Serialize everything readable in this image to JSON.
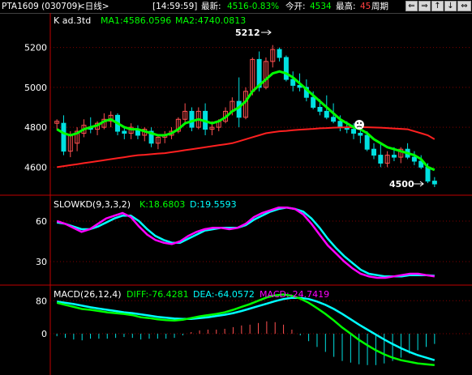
{
  "topbar": {
    "symbol": "PTA1609 (030709)",
    "period": "<日线>",
    "time": "[14:59:59]",
    "latest_label": "最新:",
    "latest_value": "4516",
    "change": "-0.83%",
    "open_label": "今开:",
    "open_value": "4534",
    "high_label": "最高:",
    "high_value": "45",
    "cycle_label": "周期",
    "nav_buttons": [
      "⇐",
      "⇒",
      "↑",
      "↓",
      "⇔"
    ]
  },
  "colors": {
    "background": "#000000",
    "grid": "#800000",
    "up": "#ff5050",
    "down": "#00e0e0",
    "ma1": "#ff00ff",
    "ma2": "#ff2020",
    "kline_overlay": "#00ff00",
    "axis_text": "#ffffff",
    "label_green": "#00ff00",
    "label_cyan": "#00ffff",
    "label_magenta": "#ff00ff",
    "label_yellow": "#ffff00"
  },
  "price_panel": {
    "title": "K  ad.3td",
    "ma1_label": "MA1:4586.0596",
    "ma2_label": "MA2:4740.0813",
    "high_annotation": "5212",
    "low_annotation": "4500",
    "yticks": [
      5200,
      5000,
      4800,
      4600
    ]
  },
  "kd_panel": {
    "title": "SLOWKD(9,3,3,2)",
    "k_label": "K:18.6803",
    "d_label": "D:19.5593",
    "yticks": [
      60,
      30
    ]
  },
  "macd_panel": {
    "title": "MACD(26,12,4)",
    "diff_label": "DIFF:-76.4281",
    "dea_label": "DEA:-64.0572",
    "macd_label": "MACD:-24.7419",
    "yticks": [
      80,
      0
    ]
  },
  "chart_data": [
    {
      "type": "candlestick",
      "title": "",
      "ylim": [
        4500,
        5300
      ],
      "candles": [
        [
          4820,
          4840,
          4790,
          4830
        ],
        [
          4820,
          4860,
          4660,
          4680
        ],
        [
          4680,
          4780,
          4650,
          4760
        ],
        [
          4720,
          4800,
          4680,
          4780
        ],
        [
          4770,
          4840,
          4750,
          4810
        ],
        [
          4800,
          4850,
          4770,
          4790
        ],
        [
          4790,
          4830,
          4760,
          4820
        ],
        [
          4800,
          4870,
          4790,
          4840
        ],
        [
          4830,
          4880,
          4800,
          4860
        ],
        [
          4860,
          4870,
          4760,
          4780
        ],
        [
          4780,
          4800,
          4740,
          4770
        ],
        [
          4770,
          4820,
          4740,
          4800
        ],
        [
          4790,
          4810,
          4740,
          4760
        ],
        [
          4760,
          4800,
          4730,
          4790
        ],
        [
          4780,
          4800,
          4700,
          4720
        ],
        [
          4720,
          4760,
          4690,
          4750
        ],
        [
          4750,
          4780,
          4720,
          4760
        ],
        [
          4760,
          4800,
          4740,
          4780
        ],
        [
          4780,
          4850,
          4770,
          4840
        ],
        [
          4840,
          4920,
          4820,
          4880
        ],
        [
          4880,
          4900,
          4780,
          4800
        ],
        [
          4800,
          4900,
          4790,
          4880
        ],
        [
          4880,
          4920,
          4760,
          4790
        ],
        [
          4790,
          4830,
          4760,
          4800
        ],
        [
          4800,
          4840,
          4780,
          4830
        ],
        [
          4830,
          4900,
          4820,
          4880
        ],
        [
          4880,
          4950,
          4860,
          4930
        ],
        [
          4930,
          5050,
          4800,
          4850
        ],
        [
          4850,
          5000,
          4840,
          4980
        ],
        [
          4980,
          5150,
          4960,
          5140
        ],
        [
          5140,
          5180,
          4980,
          5000
        ],
        [
          5000,
          5150,
          4990,
          5130
        ],
        [
          5130,
          5212,
          5100,
          5190
        ],
        [
          5190,
          5200,
          5130,
          5150
        ],
        [
          5150,
          5160,
          5030,
          5040
        ],
        [
          5040,
          5080,
          4980,
          5010
        ],
        [
          5010,
          5070,
          4980,
          5000
        ],
        [
          5000,
          5040,
          4930,
          4950
        ],
        [
          4950,
          4980,
          4890,
          4900
        ],
        [
          4900,
          4940,
          4860,
          4880
        ],
        [
          4880,
          4960,
          4840,
          4850
        ],
        [
          4850,
          4920,
          4820,
          4830
        ],
        [
          4830,
          4860,
          4780,
          4800
        ],
        [
          4800,
          4830,
          4770,
          4790
        ],
        [
          4790,
          4820,
          4740,
          4770
        ],
        [
          4770,
          4800,
          4720,
          4760
        ],
        [
          4760,
          4780,
          4680,
          4690
        ],
        [
          4690,
          4720,
          4640,
          4660
        ],
        [
          4660,
          4720,
          4600,
          4620
        ],
        [
          4620,
          4680,
          4600,
          4660
        ],
        [
          4660,
          4700,
          4630,
          4650
        ],
        [
          4650,
          4700,
          4620,
          4690
        ],
        [
          4690,
          4720,
          4640,
          4650
        ],
        [
          4650,
          4680,
          4610,
          4630
        ],
        [
          4630,
          4660,
          4590,
          4600
        ],
        [
          4600,
          4620,
          4520,
          4530
        ],
        [
          4530,
          4550,
          4500,
          4516
        ]
      ],
      "ma1": [
        4790,
        4770,
        4760,
        4770,
        4790,
        4800,
        4810,
        4830,
        4840,
        4820,
        4800,
        4790,
        4790,
        4780,
        4770,
        4760,
        4760,
        4770,
        4790,
        4820,
        4830,
        4840,
        4830,
        4820,
        4830,
        4850,
        4880,
        4900,
        4930,
        4980,
        5010,
        5040,
        5070,
        5080,
        5070,
        5050,
        5020,
        4990,
        4960,
        4930,
        4900,
        4870,
        4840,
        4820,
        4800,
        4790,
        4770,
        4740,
        4720,
        4700,
        4690,
        4680,
        4670,
        4660,
        4640,
        4600,
        4586
      ],
      "ma2": [
        4600,
        4605,
        4610,
        4615,
        4620,
        4625,
        4630,
        4635,
        4640,
        4645,
        4650,
        4655,
        4660,
        4662,
        4665,
        4668,
        4670,
        4675,
        4680,
        4685,
        4690,
        4695,
        4700,
        4705,
        4710,
        4715,
        4720,
        4730,
        4740,
        4750,
        4760,
        4770,
        4775,
        4780,
        4782,
        4785,
        4788,
        4790,
        4792,
        4795,
        4796,
        4798,
        4799,
        4800,
        4800,
        4800,
        4800,
        4799,
        4798,
        4796,
        4794,
        4792,
        4790,
        4780,
        4770,
        4760,
        4740
      ]
    },
    {
      "type": "line",
      "title": "SLOWKD(9,3,3,2)",
      "ylim": [
        15,
        75
      ],
      "series": [
        {
          "name": "K",
          "values": [
            60,
            58,
            55,
            52,
            54,
            58,
            62,
            64,
            66,
            63,
            56,
            50,
            46,
            44,
            43,
            45,
            49,
            52,
            54,
            55,
            55,
            54,
            55,
            58,
            63,
            66,
            68,
            70,
            70,
            69,
            65,
            58,
            50,
            42,
            36,
            30,
            25,
            21,
            19,
            18,
            18,
            19,
            20,
            21,
            21,
            20,
            19
          ]
        },
        {
          "name": "D",
          "values": [
            59,
            58,
            56,
            54,
            54,
            56,
            59,
            62,
            64,
            64,
            60,
            54,
            49,
            46,
            44,
            44,
            47,
            50,
            53,
            54,
            55,
            55,
            55,
            57,
            61,
            64,
            67,
            69,
            70,
            69,
            67,
            62,
            55,
            47,
            40,
            34,
            29,
            24,
            21,
            20,
            19,
            19,
            19,
            20,
            20,
            20,
            19.5
          ]
        }
      ]
    },
    {
      "type": "line",
      "title": "MACD(26,12,4)",
      "ylim": [
        -100,
        110
      ],
      "series": [
        {
          "name": "DIFF",
          "values": [
            75,
            70,
            65,
            60,
            58,
            55,
            52,
            50,
            48,
            45,
            40,
            38,
            35,
            33,
            32,
            34,
            38,
            42,
            45,
            48,
            52,
            58,
            65,
            72,
            80,
            88,
            93,
            95,
            92,
            85,
            75,
            62,
            48,
            32,
            15,
            0,
            -15,
            -28,
            -40,
            -50,
            -58,
            -64,
            -68,
            -72,
            -74,
            -76
          ]
        },
        {
          "name": "DEA",
          "values": [
            78,
            75,
            72,
            68,
            64,
            61,
            58,
            55,
            52,
            50,
            47,
            44,
            41,
            39,
            37,
            36,
            36,
            38,
            40,
            43,
            46,
            50,
            55,
            61,
            67,
            73,
            79,
            84,
            87,
            87,
            84,
            78,
            70,
            60,
            48,
            35,
            22,
            10,
            -2,
            -14,
            -25,
            -35,
            -44,
            -52,
            -58,
            -64
          ]
        },
        {
          "name": "MACD",
          "values": [
            -6,
            -10,
            -14,
            -16,
            -12,
            -12,
            -12,
            -10,
            -8,
            -10,
            -14,
            -12,
            -12,
            -12,
            -10,
            -4,
            4,
            8,
            10,
            10,
            12,
            16,
            20,
            22,
            26,
            30,
            28,
            22,
            10,
            -4,
            -18,
            -32,
            -44,
            -56,
            -66,
            -70,
            -74,
            -76,
            -76,
            -72,
            -66,
            -58,
            -48,
            -40,
            -32,
            -24.7
          ]
        }
      ]
    }
  ]
}
